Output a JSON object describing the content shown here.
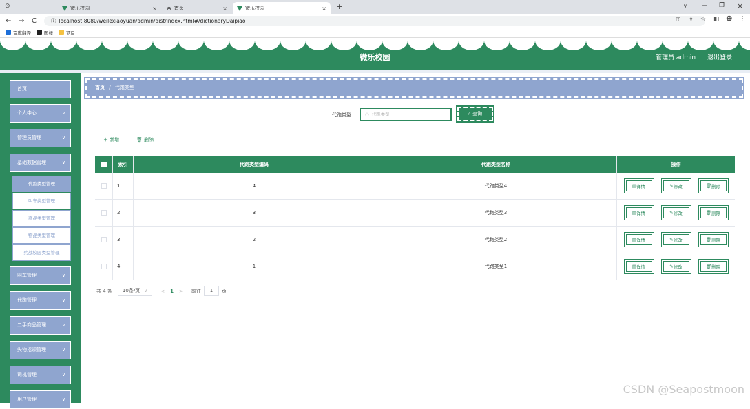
{
  "browser": {
    "tabs": [
      {
        "label": "微乐校园",
        "close": "×"
      },
      {
        "label": "首页",
        "close": "×"
      },
      {
        "label": "微乐校园",
        "close": "×"
      }
    ],
    "new_tab": "+",
    "url": "localhost:8080/weilexiaoyuan/admin/dist/index.html#/dictionaryDaipiao",
    "bookmarks": [
      "百度翻译",
      "图标",
      "项目"
    ],
    "nav": {
      "back": "←",
      "forward": "→",
      "reload": "C",
      "info": "ⓘ"
    },
    "window_controls": {
      "minimize": "−",
      "maximize": "❐",
      "close": "×",
      "chevron": "∨"
    }
  },
  "app": {
    "title": "微乐校园",
    "user": "管理员 admin",
    "logout": "退出登录",
    "theme_color": "#2d8a5e",
    "accent_color": "#8fa5cf"
  },
  "sidebar": {
    "menus": [
      {
        "label": "首页",
        "chev": ""
      },
      {
        "label": "个人中心",
        "chev": "∨"
      },
      {
        "label": "管理员管理",
        "chev": "∨"
      },
      {
        "label": "基础数据管理",
        "chev": "∨"
      },
      {
        "label": "叫车管理",
        "chev": "∨"
      },
      {
        "label": "代跑管理",
        "chev": "∨"
      },
      {
        "label": "二手商品管理",
        "chev": "∨"
      },
      {
        "label": "失物招领管理",
        "chev": "∨"
      },
      {
        "label": "司机管理",
        "chev": "∨"
      },
      {
        "label": "用户管理",
        "chev": "∨"
      }
    ],
    "submenus": [
      "代跑类型管理",
      "叫车类型管理",
      "商品类型管理",
      "物品类型管理",
      "约战校园类型管理"
    ]
  },
  "breadcrumb": {
    "home": "首页",
    "sep": "/",
    "current": "代跑类型"
  },
  "search": {
    "label": "代跑类型",
    "placeholder": "代跑类型",
    "button": "查询"
  },
  "actions": {
    "add": "新增",
    "delete": "删除"
  },
  "table": {
    "headers": [
      "索引",
      "代跑类型编码",
      "代跑类型名称",
      "操作"
    ],
    "rows": [
      {
        "index": "1",
        "code": "4",
        "name": "代跑类型4"
      },
      {
        "index": "2",
        "code": "3",
        "name": "代跑类型3"
      },
      {
        "index": "3",
        "code": "2",
        "name": "代跑类型2"
      },
      {
        "index": "4",
        "code": "1",
        "name": "代跑类型1"
      }
    ],
    "row_buttons": {
      "detail": "详情",
      "edit": "修改",
      "delete": "删除"
    }
  },
  "pagination": {
    "total": "共 4 条",
    "page_size": "10条/页",
    "prev": "<",
    "current": "1",
    "next": ">",
    "goto": "前往",
    "goto_value": "1",
    "page_unit": "页"
  },
  "watermark": "CSDN @Seapostmoon"
}
